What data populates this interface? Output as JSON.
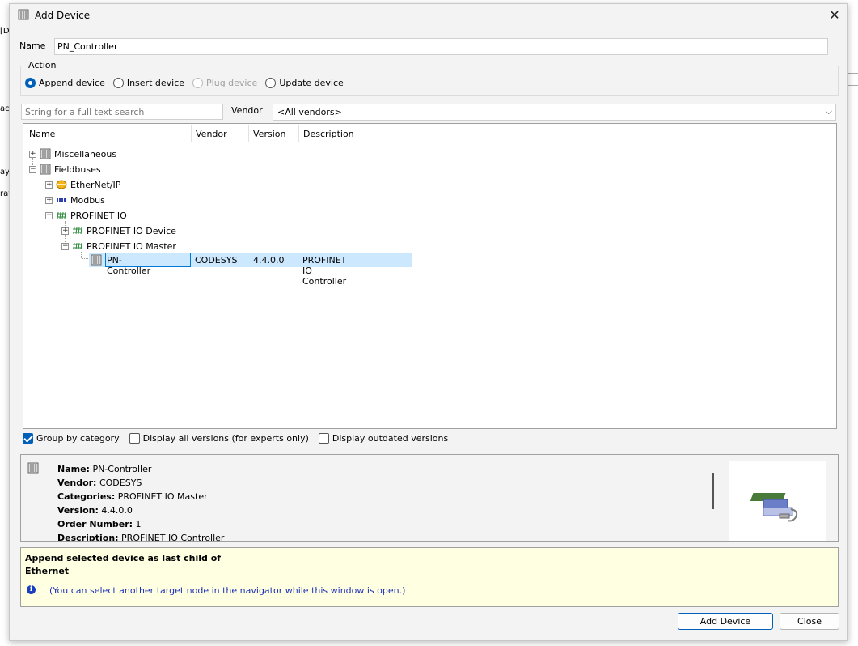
{
  "dialog": {
    "title": "Add Device"
  },
  "background": {
    "fragments": [
      "[D",
      "ac",
      "ay",
      "rat"
    ]
  },
  "name": {
    "label": "Name",
    "value": "PN_Controller"
  },
  "action": {
    "legend": "Action",
    "options": [
      {
        "label": "Append device",
        "selected": true,
        "enabled": true
      },
      {
        "label": "Insert device",
        "selected": false,
        "enabled": true
      },
      {
        "label": "Plug device",
        "selected": false,
        "enabled": false
      },
      {
        "label": "Update device",
        "selected": false,
        "enabled": true
      }
    ]
  },
  "search": {
    "placeholder": "String for a full text search"
  },
  "vendor": {
    "label": "Vendor",
    "value": "<All vendors>"
  },
  "tree": {
    "columns": [
      "Name",
      "Vendor",
      "Version",
      "Description"
    ],
    "rows": [
      {
        "name": "Miscellaneous",
        "expander": "+",
        "icon": "device-icon"
      },
      {
        "name": "Fieldbuses",
        "expander": "-",
        "icon": "device-icon"
      },
      {
        "name": "EtherNet/IP",
        "expander": "+",
        "icon": "ethernet-ip-icon"
      },
      {
        "name": "Modbus",
        "expander": "+",
        "icon": "modbus-icon"
      },
      {
        "name": "PROFINET IO",
        "expander": "-",
        "icon": "profinet-icon"
      },
      {
        "name": "PROFINET IO Device",
        "expander": "+",
        "icon": "profinet-icon"
      },
      {
        "name": "PROFINET IO Master",
        "expander": "-",
        "icon": "profinet-icon"
      }
    ],
    "selected": {
      "name": "PN-Controller",
      "vendor": "CODESYS",
      "version": "4.4.0.0",
      "description": "PROFINET IO Controller"
    }
  },
  "options": [
    {
      "label": "Group by category",
      "checked": true
    },
    {
      "label": "Display all versions (for experts only)",
      "checked": false
    },
    {
      "label": "Display outdated versions",
      "checked": false
    }
  ],
  "info": {
    "lines": [
      {
        "key": "Name:",
        "value": "PN-Controller"
      },
      {
        "key": "Vendor:",
        "value": "CODESYS"
      },
      {
        "key": "Categories:",
        "value": "PROFINET IO Master"
      },
      {
        "key": "Version:",
        "value": "4.4.0.0"
      },
      {
        "key": "Order Number:",
        "value": "1"
      },
      {
        "key": "Description:",
        "value": "PROFINET IO Controller"
      }
    ]
  },
  "hint": {
    "line1": "Append selected device as last child of",
    "line2": "Ethernet",
    "note": "(You can select another target node in the navigator while this window is open.)"
  },
  "buttons": {
    "add": "Add Device",
    "close": "Close"
  },
  "colors": {
    "accent": "#005fb8",
    "selection": "#cce8ff",
    "hint_bg": "#ffffe1",
    "hint_text": "#1c2fb8"
  }
}
